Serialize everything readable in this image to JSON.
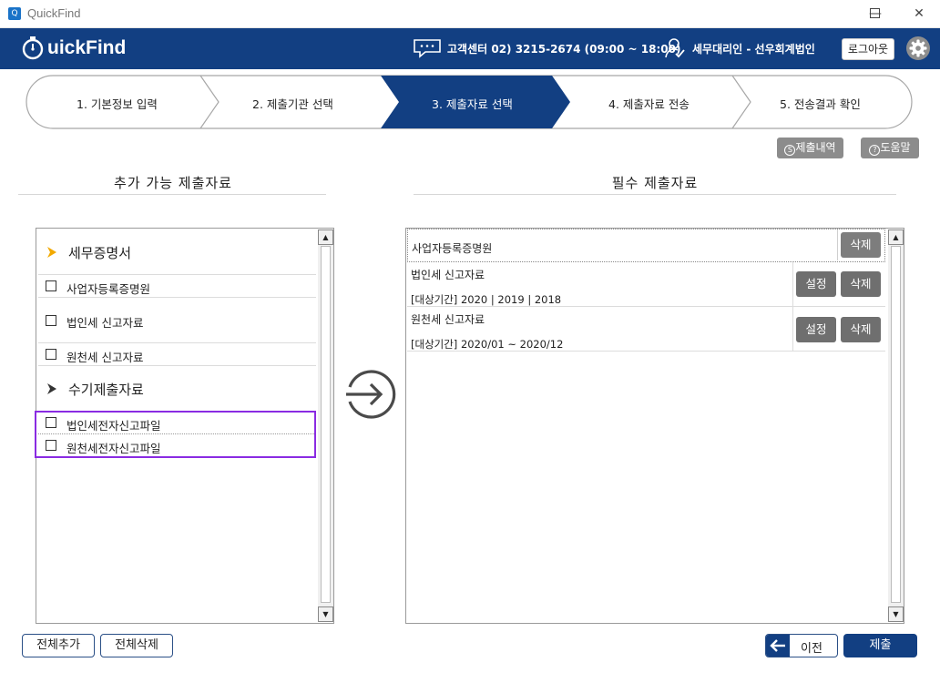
{
  "window": {
    "title": "QuickFind"
  },
  "header": {
    "logo": "QuickFind",
    "customer_center": "고객센터 02) 3215-2674 (09:00 ~ 18:00)",
    "user": "세무대리인 - 선우회계법인",
    "logout_label": "로그아웃"
  },
  "steps": [
    {
      "label": "1. 기본정보 입력",
      "active": false
    },
    {
      "label": "2. 제출기관 선택",
      "active": false
    },
    {
      "label": "3. 제출자료 선택",
      "active": true
    },
    {
      "label": "4. 제출자료 전송",
      "active": false
    },
    {
      "label": "5. 전송결과 확인",
      "active": false
    }
  ],
  "actions": {
    "history_label": "제출내역",
    "help_label": "도움말"
  },
  "left": {
    "title": "추가 가능 제출자료",
    "categories": [
      {
        "label": "세무증명서",
        "items": [
          "사업자등록증명원",
          "법인세 신고자료",
          "원천세 신고자료"
        ]
      },
      {
        "label": "수기제출자료",
        "items": [
          "법인세전자신고파일",
          "원천세전자신고파일"
        ]
      }
    ]
  },
  "right": {
    "title": "필수 제출자료",
    "rows": [
      {
        "name": "사업자등록증명원",
        "period": "",
        "settings": "",
        "delete": "삭제"
      },
      {
        "name": "법인세 신고자료",
        "period": "[대상기간]  2020 | 2019 | 2018",
        "settings": "설정",
        "delete": "삭제"
      },
      {
        "name": "원천세 신고자료",
        "period": "[대상기간]  2020/01  ~  2020/12",
        "settings": "설정",
        "delete": "삭제"
      }
    ]
  },
  "bottom": {
    "add_all": "전체추가",
    "remove_all": "전체삭제",
    "prev": "이전",
    "submit": "제출"
  },
  "colors": {
    "brand": "#123f82",
    "highlight": "#8a2be2",
    "chevron_active": "#f2a900"
  }
}
